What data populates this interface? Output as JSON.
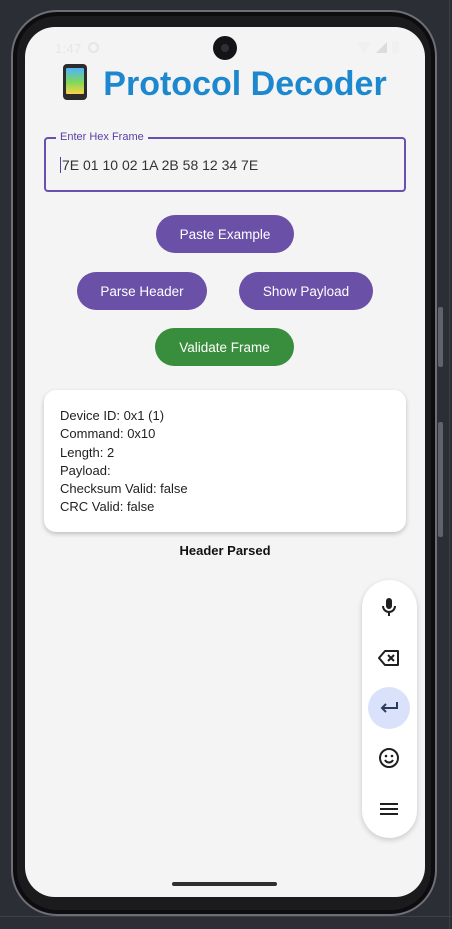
{
  "status_bar": {
    "time": "1:47"
  },
  "app": {
    "title": "Protocol Decoder",
    "title_color": "#1e88cf"
  },
  "hex_input": {
    "label": "Enter Hex Frame",
    "value": "7E 01 10 02 1A 2B 58 12 34 7E"
  },
  "buttons": {
    "paste_example": "Paste Example",
    "parse_header": "Parse Header",
    "show_payload": "Show Payload",
    "validate_frame": "Validate Frame",
    "primary_color": "#6a50a7",
    "validate_color": "#388e3c"
  },
  "result": {
    "lines": [
      "Device ID: 0x1 (1)",
      "Command: 0x10",
      "Length: 2",
      "Payload:",
      "Checksum Valid: false",
      "CRC Valid: false"
    ]
  },
  "status_message": "Header Parsed",
  "keyboard_toolbar": {
    "icons": [
      "mic-icon",
      "backspace-icon",
      "enter-icon",
      "emoji-icon",
      "menu-icon"
    ],
    "active": "enter-icon"
  }
}
